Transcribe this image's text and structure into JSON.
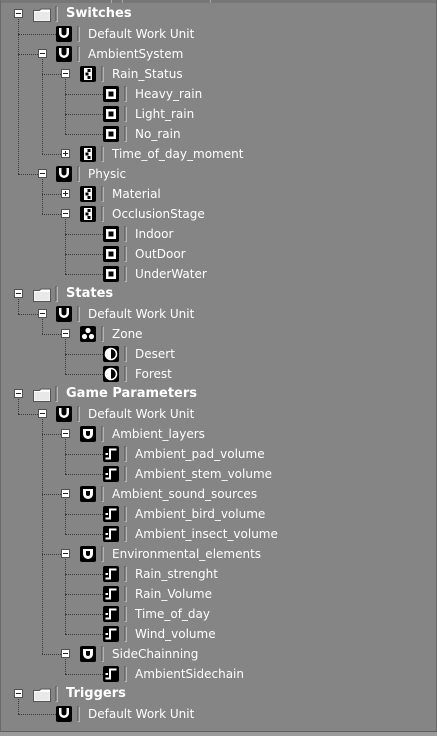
{
  "tree": [
    {
      "label": "Switches",
      "kind": "folder",
      "depth": 0,
      "toggle": "minus",
      "icon": "folder-icon",
      "bold": true
    },
    {
      "label": "Default Work Unit",
      "kind": "item",
      "depth": 1,
      "toggle": null,
      "icon": "work-unit-icon"
    },
    {
      "label": "AmbientSystem",
      "kind": "item",
      "depth": 1,
      "toggle": "minus",
      "icon": "work-unit-icon"
    },
    {
      "label": "Rain_Status",
      "kind": "item",
      "depth": 2,
      "toggle": "minus",
      "icon": "switch-group-icon"
    },
    {
      "label": "Heavy_rain",
      "kind": "item",
      "depth": 3,
      "toggle": null,
      "icon": "switch-icon"
    },
    {
      "label": "Light_rain",
      "kind": "item",
      "depth": 3,
      "toggle": null,
      "icon": "switch-icon"
    },
    {
      "label": "No_rain",
      "kind": "item",
      "depth": 3,
      "toggle": null,
      "icon": "switch-icon"
    },
    {
      "label": "Time_of_day_moment",
      "kind": "item",
      "depth": 2,
      "toggle": "plus",
      "icon": "switch-group-icon"
    },
    {
      "label": "Physic",
      "kind": "item",
      "depth": 1,
      "toggle": "minus",
      "icon": "work-unit-icon"
    },
    {
      "label": "Material",
      "kind": "item",
      "depth": 2,
      "toggle": "plus",
      "icon": "switch-group-icon"
    },
    {
      "label": "OcclusionStage",
      "kind": "item",
      "depth": 2,
      "toggle": "minus",
      "icon": "switch-group-icon"
    },
    {
      "label": "Indoor",
      "kind": "item",
      "depth": 3,
      "toggle": null,
      "icon": "switch-icon"
    },
    {
      "label": "OutDoor",
      "kind": "item",
      "depth": 3,
      "toggle": null,
      "icon": "switch-icon"
    },
    {
      "label": "UnderWater",
      "kind": "item",
      "depth": 3,
      "toggle": null,
      "icon": "switch-icon"
    },
    {
      "label": "States",
      "kind": "folder",
      "depth": 0,
      "toggle": "minus",
      "icon": "folder-icon",
      "bold": true
    },
    {
      "label": "Default Work Unit",
      "kind": "item",
      "depth": 1,
      "toggle": "minus",
      "icon": "work-unit-icon"
    },
    {
      "label": "Zone",
      "kind": "item",
      "depth": 2,
      "toggle": "minus",
      "icon": "state-group-icon"
    },
    {
      "label": "Desert",
      "kind": "item",
      "depth": 3,
      "toggle": null,
      "icon": "state-icon"
    },
    {
      "label": "Forest",
      "kind": "item",
      "depth": 3,
      "toggle": null,
      "icon": "state-icon"
    },
    {
      "label": "Game Parameters",
      "kind": "folder",
      "depth": 0,
      "toggle": "minus",
      "icon": "folder-icon",
      "bold": true
    },
    {
      "label": "Default Work Unit",
      "kind": "item",
      "depth": 1,
      "toggle": "minus",
      "icon": "work-unit-icon"
    },
    {
      "label": "Ambient_layers",
      "kind": "item",
      "depth": 2,
      "toggle": "minus",
      "icon": "virtual-folder-icon"
    },
    {
      "label": "Ambient_pad_volume",
      "kind": "item",
      "depth": 3,
      "toggle": null,
      "icon": "game-parameter-icon"
    },
    {
      "label": "Ambient_stem_volume",
      "kind": "item",
      "depth": 3,
      "toggle": null,
      "icon": "game-parameter-icon"
    },
    {
      "label": "Ambient_sound_sources",
      "kind": "item",
      "depth": 2,
      "toggle": "minus",
      "icon": "virtual-folder-icon"
    },
    {
      "label": "Ambient_bird_volume",
      "kind": "item",
      "depth": 3,
      "toggle": null,
      "icon": "game-parameter-icon"
    },
    {
      "label": "Ambient_insect_volume",
      "kind": "item",
      "depth": 3,
      "toggle": null,
      "icon": "game-parameter-icon"
    },
    {
      "label": "Environmental_elements",
      "kind": "item",
      "depth": 2,
      "toggle": "minus",
      "icon": "virtual-folder-icon"
    },
    {
      "label": "Rain_strenght",
      "kind": "item",
      "depth": 3,
      "toggle": null,
      "icon": "game-parameter-icon"
    },
    {
      "label": "Rain_Volume",
      "kind": "item",
      "depth": 3,
      "toggle": null,
      "icon": "game-parameter-icon"
    },
    {
      "label": "Time_of_day",
      "kind": "item",
      "depth": 3,
      "toggle": null,
      "icon": "game-parameter-icon"
    },
    {
      "label": "Wind_volume",
      "kind": "item",
      "depth": 3,
      "toggle": null,
      "icon": "game-parameter-icon"
    },
    {
      "label": "SideChainning",
      "kind": "item",
      "depth": 2,
      "toggle": "minus",
      "icon": "virtual-folder-icon"
    },
    {
      "label": "AmbientSidechain",
      "kind": "item",
      "depth": 3,
      "toggle": null,
      "icon": "game-parameter-icon"
    },
    {
      "label": "Triggers",
      "kind": "folder",
      "depth": 0,
      "toggle": "minus",
      "icon": "folder-icon",
      "bold": true
    },
    {
      "label": "Default Work Unit",
      "kind": "item",
      "depth": 1,
      "toggle": null,
      "icon": "work-unit-icon"
    }
  ],
  "colors": {
    "background": "#858585",
    "text": "#ffffff",
    "icon_bg": "#000000",
    "connector": "#3a3a3a"
  }
}
